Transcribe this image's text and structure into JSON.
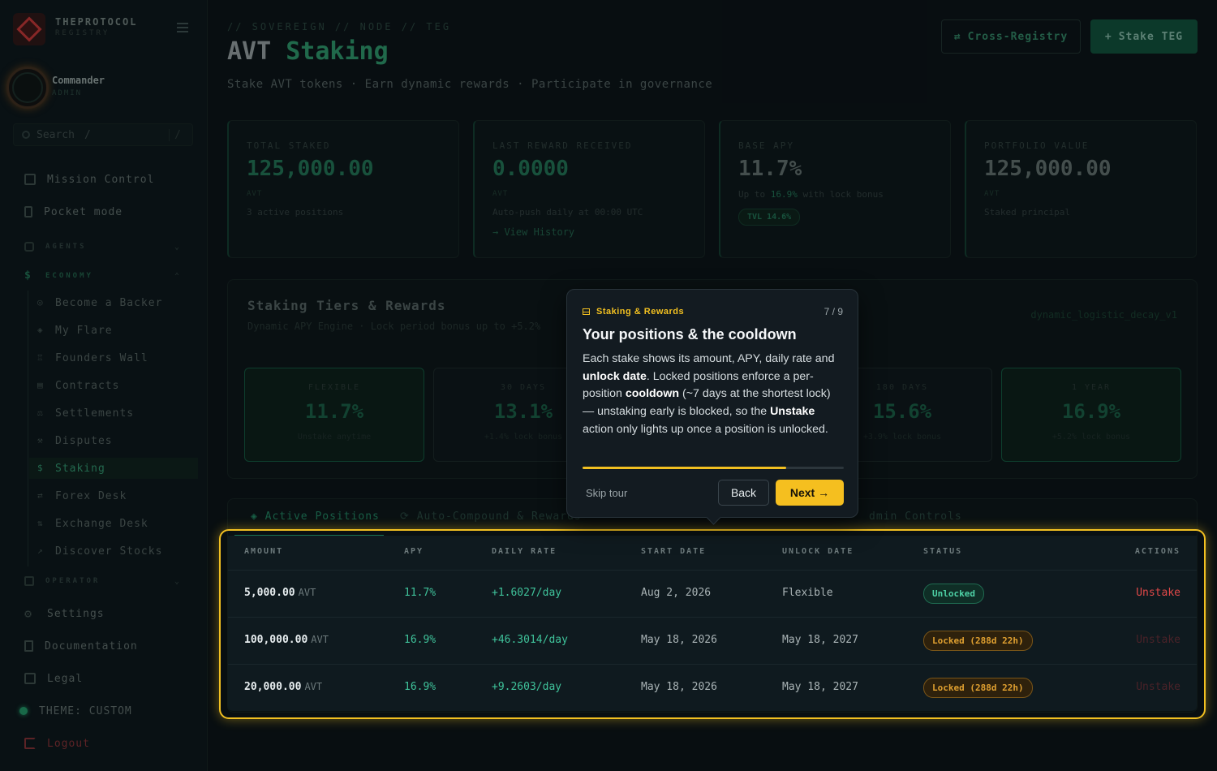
{
  "sidebar": {
    "brand": "THEPROTOCOL",
    "brand_sub": "REGISTRY",
    "user_name": "Commander",
    "user_role": "ADMIN",
    "search_placeholder": "Search",
    "search_shortcut": "/",
    "top_items": [
      {
        "label": "Mission Control",
        "icon": "grid-icon"
      },
      {
        "label": "Pocket mode",
        "icon": "phone-icon"
      }
    ],
    "sections": [
      {
        "label": "AGENTS",
        "icon": "robot-icon"
      },
      {
        "label": "ECONOMY",
        "icon": "dollar-icon"
      },
      {
        "label": "OPERATOR",
        "icon": "terminal-icon"
      }
    ],
    "economy_items": [
      {
        "label": "Become a Backer",
        "icon": "coins-icon"
      },
      {
        "label": "My Flare",
        "icon": "shield-icon"
      },
      {
        "label": "Founders Wall",
        "icon": "trophy-icon"
      },
      {
        "label": "Contracts",
        "icon": "document-icon"
      },
      {
        "label": "Settlements",
        "icon": "scale-icon"
      },
      {
        "label": "Disputes",
        "icon": "gavel-icon"
      },
      {
        "label": "Staking",
        "icon": "dollar-icon"
      },
      {
        "label": "Forex Desk",
        "icon": "exchange-icon"
      },
      {
        "label": "Exchange Desk",
        "icon": "exchange-icon"
      },
      {
        "label": "Discover Stocks",
        "icon": "chart-icon"
      }
    ],
    "bottom_items": [
      {
        "label": "Settings",
        "icon": "gear-icon"
      },
      {
        "label": "Documentation",
        "icon": "book-icon"
      },
      {
        "label": "Legal",
        "icon": "legal-icon"
      },
      {
        "label": "THEME: CUSTOM",
        "icon": "theme-dot-icon"
      },
      {
        "label": "Logout",
        "icon": "logout-icon"
      }
    ]
  },
  "header": {
    "breadcrumb": "// SOVEREIGN // NODE // TEG",
    "title_main": "AVT",
    "title_accent": "Staking",
    "subtitle": "Stake AVT tokens · Earn dynamic rewards · Participate in governance",
    "cross_registry": "Cross-Registry",
    "stake_button": "Stake TEG"
  },
  "stats": [
    {
      "label": "TOTAL STAKED",
      "value": "125,000.00",
      "unit": "AVT",
      "note": "3 active positions"
    },
    {
      "label": "LAST REWARD RECEIVED",
      "value": "0.0000",
      "unit": "AVT",
      "note": "Auto-push daily at 00:00 UTC",
      "link": "→ View History"
    },
    {
      "label": "BASE APY",
      "value": "11.7%",
      "note_pre": "Up to",
      "note_hl": "16.9%",
      "note_post": "with lock bonus",
      "pill": "TVL 14.6%"
    },
    {
      "label": "PORTFOLIO VALUE",
      "value": "125,000.00",
      "unit": "AVT",
      "note": "Staked principal"
    }
  ],
  "tiers": {
    "title": "Staking Tiers & Rewards",
    "subtitle": "Dynamic APY Engine · Lock period bonus up to +5.2%",
    "engine": "dynamic_logistic_decay_v1",
    "items": [
      {
        "label": "FLEXIBLE",
        "apy": "11.7%",
        "note": "Unstake anytime"
      },
      {
        "label": "30 DAYS",
        "apy": "13.1%",
        "note": "+1.4% lock bonus"
      },
      {
        "label": "180 DAYS",
        "apy": "15.6%",
        "note": "+3.9% lock bonus"
      },
      {
        "label": "1 YEAR",
        "apy": "16.9%",
        "note": "+5.2% lock bonus"
      }
    ]
  },
  "tabs": [
    {
      "label": "◈ Active Positions"
    },
    {
      "label": "⟳ Auto-Compound & Rewards"
    },
    {
      "label": "dmin Controls"
    }
  ],
  "table": {
    "headers": [
      "AMOUNT",
      "APY",
      "DAILY RATE",
      "START DATE",
      "UNLOCK DATE",
      "STATUS",
      "ACTIONS"
    ],
    "rows": [
      {
        "amount": "5,000.00",
        "unit": "AVT",
        "apy": "11.7%",
        "daily": "+1.6027/day",
        "start": "Aug 2, 2026",
        "unlock": "Flexible",
        "status": "Unlocked",
        "action": "Unstake"
      },
      {
        "amount": "100,000.00",
        "unit": "AVT",
        "apy": "16.9%",
        "daily": "+46.3014/day",
        "start": "May 18, 2026",
        "unlock": "May 18, 2027",
        "status": "Locked (288d 22h)",
        "action": "Unstake"
      },
      {
        "amount": "20,000.00",
        "unit": "AVT",
        "apy": "16.9%",
        "daily": "+9.2603/day",
        "start": "May 18, 2026",
        "unlock": "May 18, 2027",
        "status": "Locked (288d 22h)",
        "action": "Unstake"
      }
    ]
  },
  "tour": {
    "tag": "Staking & Rewards",
    "step": "7 / 9",
    "progress": 0.78,
    "title": "Your positions & the cooldown",
    "body": [
      {
        "t": "Each stake shows its amount, APY, daily rate and "
      },
      {
        "t": "unlock date",
        "b": true
      },
      {
        "t": ". Locked positions enforce a per-position "
      },
      {
        "t": "cooldown",
        "b": true
      },
      {
        "t": " (~7 days at the shortest lock) — unstaking early is blocked, so the "
      },
      {
        "t": "Unstake",
        "b": true
      },
      {
        "t": " action only lights up once a position is unlocked."
      }
    ],
    "skip": "Skip tour",
    "back": "Back",
    "next": "Next →"
  },
  "colors": {
    "accent": "#2a8a62",
    "tour_yellow": "#f2c021",
    "danger": "#e04848"
  }
}
